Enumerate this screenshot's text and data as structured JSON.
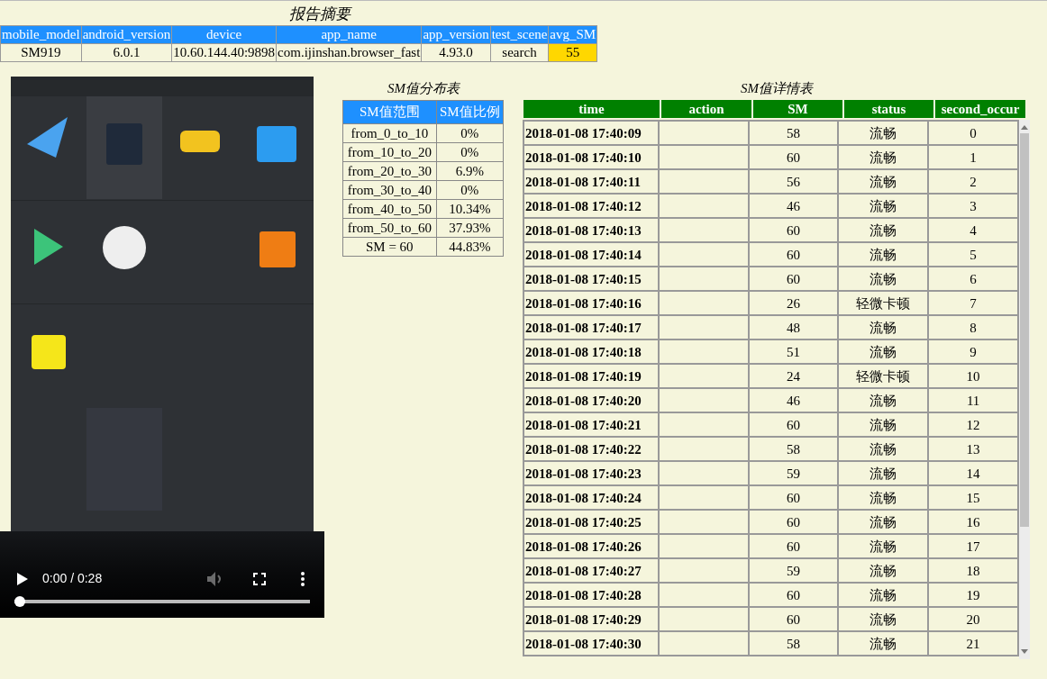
{
  "summary": {
    "title": "报告摘要",
    "columns": [
      "mobile_model",
      "android_version",
      "device",
      "app_name",
      "app_version",
      "test_scene",
      "avg_SM"
    ],
    "row": [
      {
        "text": "SM919",
        "highlighted": false
      },
      {
        "text": "6.0.1",
        "highlighted": false
      },
      {
        "text": "10.60.144.40:9898",
        "highlighted": false
      },
      {
        "text": "com.ijinshan.browser_fast",
        "highlighted": false
      },
      {
        "text": "4.93.0",
        "highlighted": false
      },
      {
        "text": "search",
        "highlighted": false
      },
      {
        "text": "55",
        "highlighted": true
      }
    ]
  },
  "video": {
    "kind": "picture",
    "playing": false,
    "time": "0:00 / 0:28",
    "progress": {
      "level": 0
    }
  },
  "distribution": {
    "title": "SM值分布表",
    "columns": [
      "SM值范围",
      "SM值比例"
    ],
    "rows": [
      [
        "from_0_to_10",
        "0%"
      ],
      [
        "from_10_to_20",
        "0%"
      ],
      [
        "from_20_to_30",
        "6.9%"
      ],
      [
        "from_30_to_40",
        "0%"
      ],
      [
        "from_40_to_50",
        "10.34%"
      ],
      [
        "from_50_to_60",
        "37.93%"
      ],
      [
        "SM = 60",
        "44.83%"
      ]
    ]
  },
  "details": {
    "title": "SM值详情表",
    "columns": [
      "time",
      "action",
      "SM",
      "status",
      "second_occur"
    ],
    "rows": [
      [
        "2018-01-08 17:40:09",
        "",
        "58",
        "流畅",
        "0"
      ],
      [
        "2018-01-08 17:40:10",
        "",
        "60",
        "流畅",
        "1"
      ],
      [
        "2018-01-08 17:40:11",
        "",
        "56",
        "流畅",
        "2"
      ],
      [
        "2018-01-08 17:40:12",
        "",
        "46",
        "流畅",
        "3"
      ],
      [
        "2018-01-08 17:40:13",
        "",
        "60",
        "流畅",
        "4"
      ],
      [
        "2018-01-08 17:40:14",
        "",
        "60",
        "流畅",
        "5"
      ],
      [
        "2018-01-08 17:40:15",
        "",
        "60",
        "流畅",
        "6"
      ],
      [
        "2018-01-08 17:40:16",
        "",
        "26",
        "轻微卡顿",
        "7"
      ],
      [
        "2018-01-08 17:40:17",
        "",
        "48",
        "流畅",
        "8"
      ],
      [
        "2018-01-08 17:40:18",
        "",
        "51",
        "流畅",
        "9"
      ],
      [
        "2018-01-08 17:40:19",
        "",
        "24",
        "轻微卡顿",
        "10"
      ],
      [
        "2018-01-08 17:40:20",
        "",
        "46",
        "流畅",
        "11"
      ],
      [
        "2018-01-08 17:40:21",
        "",
        "60",
        "流畅",
        "12"
      ],
      [
        "2018-01-08 17:40:22",
        "",
        "58",
        "流畅",
        "13"
      ],
      [
        "2018-01-08 17:40:23",
        "",
        "59",
        "流畅",
        "14"
      ],
      [
        "2018-01-08 17:40:24",
        "",
        "60",
        "流畅",
        "15"
      ],
      [
        "2018-01-08 17:40:25",
        "",
        "60",
        "流畅",
        "16"
      ],
      [
        "2018-01-08 17:40:26",
        "",
        "60",
        "流畅",
        "17"
      ],
      [
        "2018-01-08 17:40:27",
        "",
        "59",
        "流畅",
        "18"
      ],
      [
        "2018-01-08 17:40:28",
        "",
        "60",
        "流畅",
        "19"
      ],
      [
        "2018-01-08 17:40:29",
        "",
        "60",
        "流畅",
        "20"
      ],
      [
        "2018-01-08 17:40:30",
        "",
        "58",
        "流畅",
        "21"
      ]
    ]
  }
}
